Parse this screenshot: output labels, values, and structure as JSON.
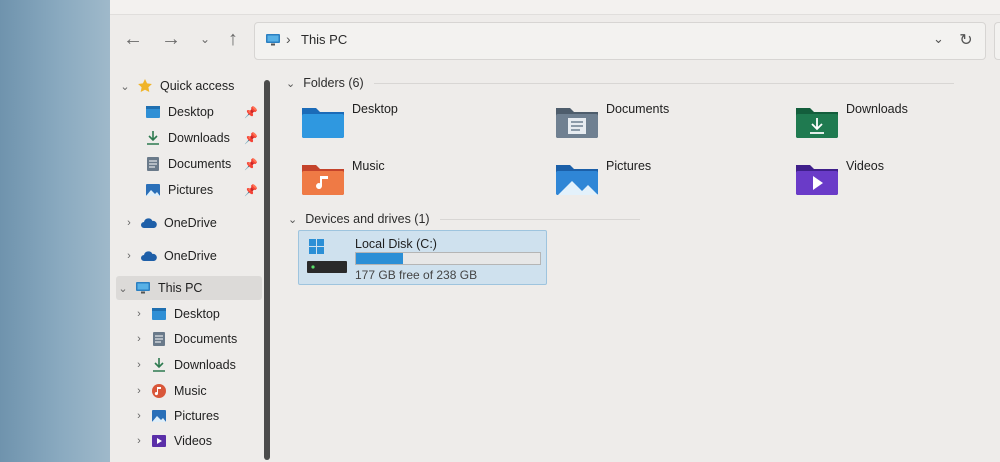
{
  "address": {
    "crumb": "This PC"
  },
  "sidebar": {
    "quick_access": {
      "label": "Quick access",
      "items": [
        {
          "label": "Desktop",
          "icon": "desktop-icon"
        },
        {
          "label": "Downloads",
          "icon": "download-icon"
        },
        {
          "label": "Documents",
          "icon": "document-icon"
        },
        {
          "label": "Pictures",
          "icon": "pictures-icon"
        }
      ]
    },
    "onedrive1": "OneDrive",
    "onedrive2": "OneDrive",
    "this_pc": {
      "label": "This PC",
      "items": [
        {
          "label": "Desktop"
        },
        {
          "label": "Documents"
        },
        {
          "label": "Downloads"
        },
        {
          "label": "Music"
        },
        {
          "label": "Pictures"
        },
        {
          "label": "Videos"
        }
      ]
    }
  },
  "main": {
    "folders_header": "Folders (6)",
    "folders": [
      {
        "label": "Desktop"
      },
      {
        "label": "Documents"
      },
      {
        "label": "Downloads"
      },
      {
        "label": "Music"
      },
      {
        "label": "Pictures"
      },
      {
        "label": "Videos"
      }
    ],
    "drives_header": "Devices and drives (1)",
    "drive": {
      "name": "Local Disk (C:)",
      "free_text": "177 GB free of 238 GB",
      "used_fraction": 0.256
    }
  },
  "colors": {
    "accent": "#2b8fd6",
    "selection": "#cfe1ee"
  }
}
